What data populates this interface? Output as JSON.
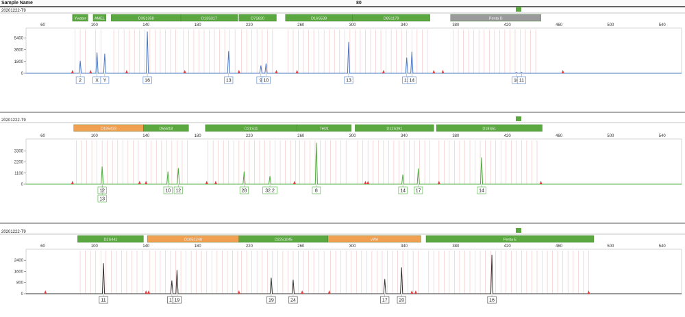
{
  "header": {
    "sample_name_label": "Sample Name",
    "column2_label": "80"
  },
  "colors": {
    "blue_trace": "#4a78c4",
    "green_trace": "#4caf3c",
    "black_trace": "#333333",
    "marker_green": "#5aa83f",
    "marker_orange": "#f0a050",
    "marker_gray": "#9a9a9a",
    "peak_red": "#e04040",
    "bin_pink": "#f3c9c9"
  },
  "chart_data": [
    {
      "type": "line",
      "sample": "20201222-T9",
      "dye": "blue",
      "x_ticks": [
        60,
        100,
        140,
        180,
        220,
        260,
        300,
        340,
        380,
        420,
        460,
        500,
        540
      ],
      "y_ticks": [
        0,
        1800,
        3600,
        5400
      ],
      "xlim": [
        47,
        555
      ],
      "ylim": [
        0,
        6500
      ],
      "markers": [
        {
          "label": "Ywater",
          "start": 83,
          "end": 95,
          "kind": "green"
        },
        {
          "label": "AMEL",
          "start": 99,
          "end": 109,
          "kind": "green"
        },
        {
          "label": "D3S1358",
          "start": 113,
          "end": 167,
          "kind": "green"
        },
        {
          "label": "D13S317",
          "start": 167,
          "end": 211,
          "kind": "green"
        },
        {
          "label": "D7S820",
          "start": 212,
          "end": 241,
          "kind": "green"
        },
        {
          "label": "D16S539",
          "start": 248,
          "end": 300,
          "kind": "green"
        },
        {
          "label": "D8S1179",
          "start": 300,
          "end": 360,
          "kind": "green"
        },
        {
          "label": "Penta D",
          "start": 376,
          "end": 446,
          "kind": "gray"
        }
      ],
      "peaks": [
        {
          "x": 89,
          "h": 1900,
          "labels": [
            "2"
          ]
        },
        {
          "x": 102,
          "h": 3200,
          "labels": [
            "X"
          ]
        },
        {
          "x": 108,
          "h": 3000,
          "labels": [
            "Y"
          ]
        },
        {
          "x": 141,
          "h": 6400,
          "labels": [
            "16"
          ]
        },
        {
          "x": 204,
          "h": 3400,
          "labels": [
            "13"
          ]
        },
        {
          "x": 229,
          "h": 1200,
          "labels": [
            "9"
          ]
        },
        {
          "x": 233,
          "h": 1500,
          "labels": [
            "10"
          ]
        },
        {
          "x": 297,
          "h": 4800,
          "labels": [
            "13"
          ]
        },
        {
          "x": 342,
          "h": 2400,
          "labels": [
            "13"
          ]
        },
        {
          "x": 346,
          "h": 3300,
          "labels": [
            "14"
          ]
        },
        {
          "x": 427,
          "h": 150,
          "labels": [
            "10"
          ]
        },
        {
          "x": 431,
          "h": 150,
          "labels": [
            "11"
          ]
        }
      ],
      "red_marks": [
        83,
        97,
        125,
        170,
        212,
        241,
        257,
        324,
        363,
        370,
        463
      ]
    },
    {
      "type": "line",
      "sample": "20201222-T9",
      "dye": "green",
      "x_ticks": [
        60,
        100,
        140,
        180,
        220,
        260,
        300,
        340,
        380,
        420,
        460,
        500,
        540
      ],
      "y_ticks": [
        0,
        1100,
        2200,
        3300
      ],
      "xlim": [
        47,
        555
      ],
      "ylim": [
        0,
        4200
      ],
      "markers": [
        {
          "label": "D19S433",
          "start": 84,
          "end": 138,
          "kind": "orange"
        },
        {
          "label": "D5S818",
          "start": 138,
          "end": 173,
          "kind": "green"
        },
        {
          "label": "D21S11",
          "start": 186,
          "end": 257,
          "kind": "green"
        },
        {
          "label": "TH01",
          "start": 257,
          "end": 299,
          "kind": "green"
        },
        {
          "label": "D12S391",
          "start": 302,
          "end": 363,
          "kind": "green"
        },
        {
          "label": "D18S51",
          "start": 365,
          "end": 447,
          "kind": "green"
        }
      ],
      "peaks": [
        {
          "x": 106,
          "h": 1750,
          "labels": [
            "12",
            "13"
          ]
        },
        {
          "x": 157,
          "h": 1250,
          "labels": [
            "10"
          ]
        },
        {
          "x": 165,
          "h": 1600,
          "labels": [
            "12"
          ]
        },
        {
          "x": 216,
          "h": 1250,
          "labels": [
            "28"
          ]
        },
        {
          "x": 236,
          "h": 800,
          "labels": [
            "32.2"
          ]
        },
        {
          "x": 272,
          "h": 4100,
          "labels": [
            "8"
          ]
        },
        {
          "x": 339,
          "h": 950,
          "labels": [
            "14"
          ]
        },
        {
          "x": 351,
          "h": 1550,
          "labels": [
            "17"
          ]
        },
        {
          "x": 400,
          "h": 2650,
          "labels": [
            "14"
          ]
        }
      ],
      "red_marks": [
        83,
        135,
        140,
        187,
        194,
        255,
        310,
        312,
        367,
        446
      ]
    },
    {
      "type": "line",
      "sample": "20201222-T9",
      "dye": "black",
      "x_ticks": [
        60,
        100,
        140,
        180,
        220,
        260,
        300,
        340,
        380,
        420,
        460,
        500,
        540
      ],
      "y_ticks": [
        0,
        800,
        1600,
        2400
      ],
      "xlim": [
        47,
        555
      ],
      "ylim": [
        0,
        3000
      ],
      "markers": [
        {
          "label": "D2S441",
          "start": 87,
          "end": 138,
          "kind": "green"
        },
        {
          "label": "D10S1248",
          "start": 141,
          "end": 212,
          "kind": "orange"
        },
        {
          "label": "D22S1045",
          "start": 212,
          "end": 281,
          "kind": "green"
        },
        {
          "label": "vWA",
          "start": 281,
          "end": 353,
          "kind": "orange"
        },
        {
          "label": "Penta E",
          "start": 357,
          "end": 487,
          "kind": "green"
        }
      ],
      "peaks": [
        {
          "x": 107,
          "h": 2200,
          "labels": [
            "11"
          ]
        },
        {
          "x": 160,
          "h": 950,
          "labels": [
            "17"
          ]
        },
        {
          "x": 164,
          "h": 1700,
          "labels": [
            "19"
          ]
        },
        {
          "x": 237,
          "h": 1150,
          "labels": [
            "19"
          ]
        },
        {
          "x": 254,
          "h": 1000,
          "labels": [
            "24"
          ]
        },
        {
          "x": 325,
          "h": 1050,
          "labels": [
            "17"
          ]
        },
        {
          "x": 338,
          "h": 1900,
          "labels": [
            "20"
          ]
        },
        {
          "x": 408,
          "h": 2800,
          "labels": [
            "16"
          ]
        }
      ],
      "red_marks": [
        62,
        140,
        142,
        212,
        261,
        282,
        346,
        349,
        483
      ]
    }
  ]
}
